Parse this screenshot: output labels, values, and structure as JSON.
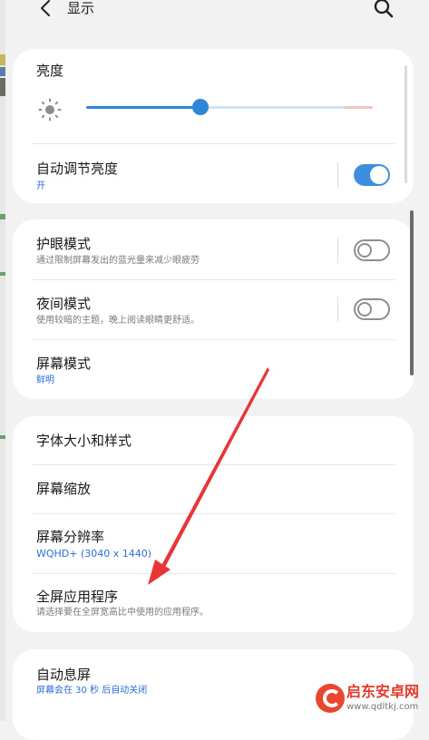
{
  "header": {
    "title": "显示",
    "back_icon": "chevron-left-icon",
    "search_icon": "search-icon"
  },
  "brightness": {
    "title": "亮度",
    "icon": "sun-icon",
    "level_fraction": 0.4
  },
  "auto_brightness": {
    "label": "自动调节亮度",
    "status": "开",
    "enabled": true
  },
  "eye_comfort": {
    "label": "护眼模式",
    "description": "通过限制屏幕发出的蓝光量来减少眼疲劳",
    "enabled": false
  },
  "night_mode": {
    "label": "夜间模式",
    "description": "使用较暗的主题，晚上阅读眼睛更舒适。",
    "enabled": false
  },
  "screen_mode": {
    "label": "屏幕模式",
    "value": "鲜明"
  },
  "font": {
    "label": "字体大小和样式"
  },
  "zoom": {
    "label": "屏幕缩放"
  },
  "resolution": {
    "label": "屏幕分辨率",
    "value": "WQHD+ (3040 x 1440)"
  },
  "fullscreen_apps": {
    "label": "全屏应用程序",
    "description": "请选择要在全屏宽高比中使用的应用程序。"
  },
  "screen_timeout": {
    "label": "自动息屏",
    "value": "屏幕会在 30 秒 后自动关闭"
  },
  "watermark": {
    "title": "启东安卓网",
    "url": "www.qdltkj.com"
  },
  "colors": {
    "accent": "#3e8ede",
    "link_text": "#2b6fd6",
    "annotation_arrow": "#e8353a"
  }
}
